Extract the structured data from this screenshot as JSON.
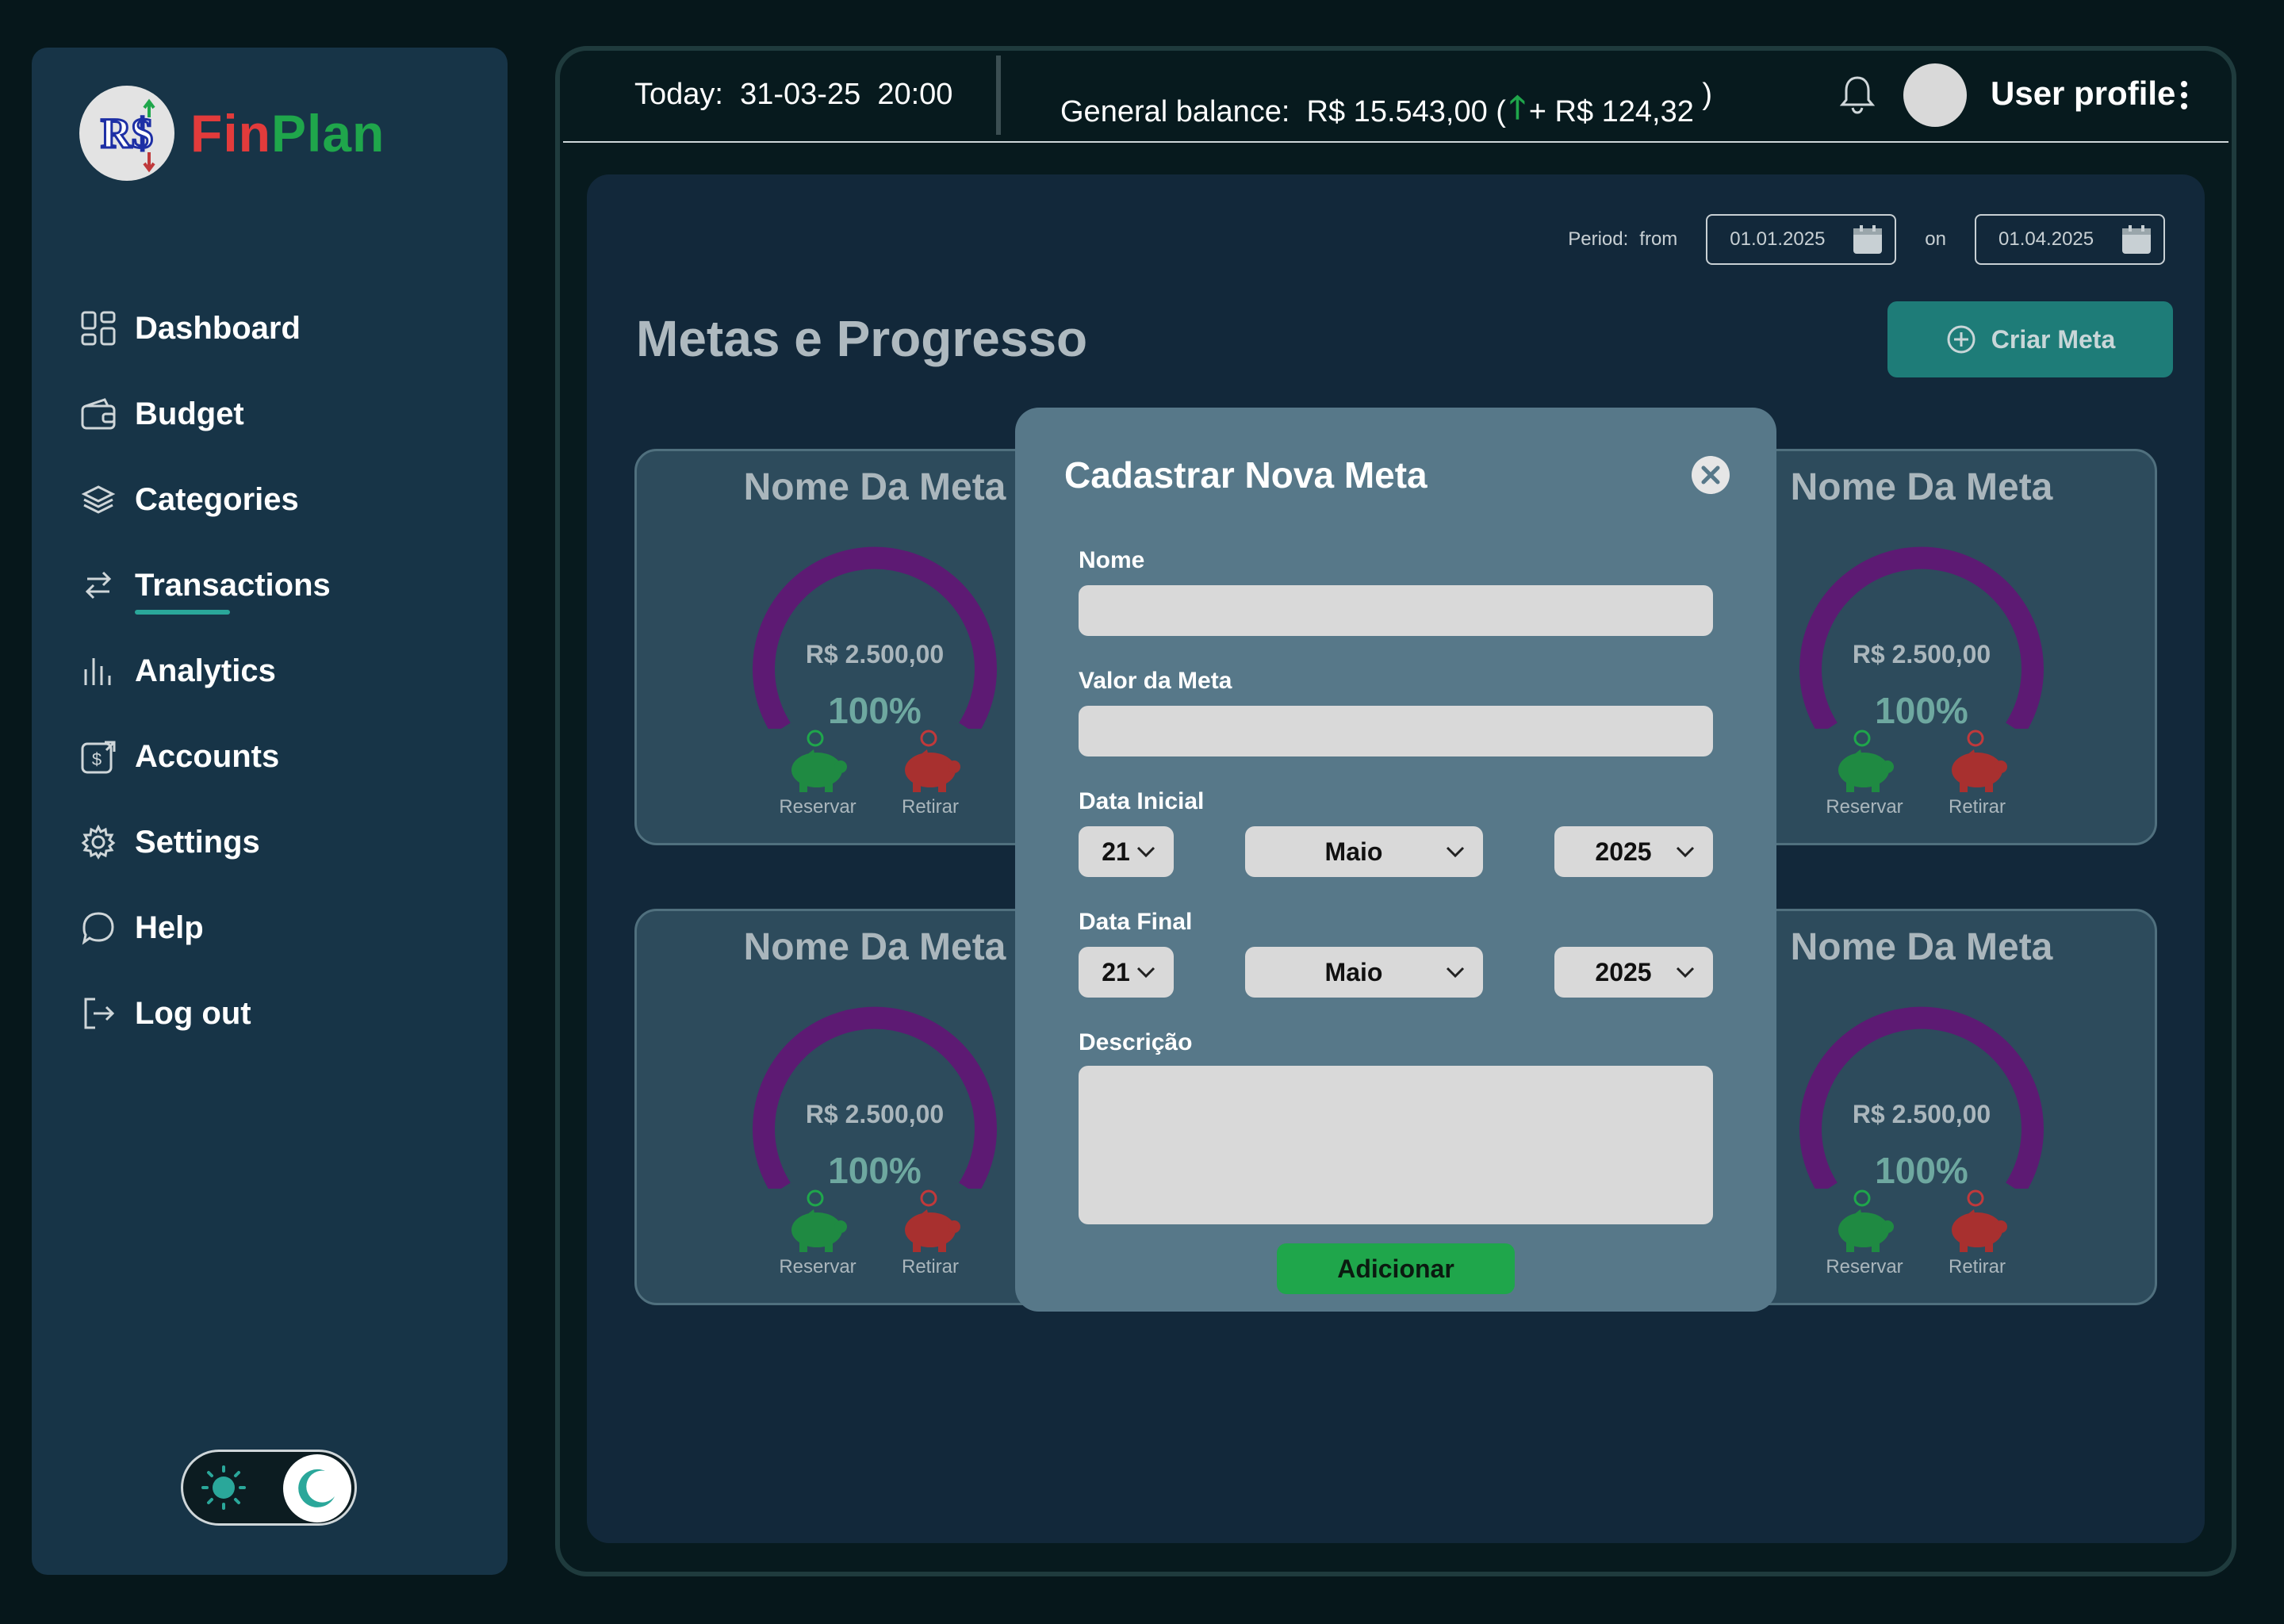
{
  "brand": {
    "name_part1": "Fin",
    "name_part2": "Plan",
    "logo_text": "R$"
  },
  "sidebar": {
    "items": [
      {
        "label": "Dashboard",
        "icon": "dashboard-icon"
      },
      {
        "label": "Budget",
        "icon": "wallet-icon"
      },
      {
        "label": "Categories",
        "icon": "layers-icon"
      },
      {
        "label": "Transactions",
        "icon": "transfer-arrows-icon",
        "active": true
      },
      {
        "label": "Analytics",
        "icon": "bar-chart-icon"
      },
      {
        "label": "Accounts",
        "icon": "dollar-account-icon"
      },
      {
        "label": "Settings",
        "icon": "gear-icon"
      },
      {
        "label": "Help",
        "icon": "chat-bubble-icon"
      },
      {
        "label": "Log out",
        "icon": "logout-icon"
      }
    ],
    "theme": "dark"
  },
  "topbar": {
    "today_label": "Today:",
    "today_date": "31-03-25",
    "today_time": "20:00",
    "balance_label": "General balance:",
    "balance_value": "R$ 15.543,00",
    "balance_change": "+ R$ 124,32",
    "profile_label": "User profile"
  },
  "filters": {
    "period_label": "Period:",
    "from_label": "from",
    "from_date": "01.01.2025",
    "to_label": "on",
    "to_date": "01.04.2025"
  },
  "page": {
    "title": "Metas e Progresso",
    "create_button": "Criar Meta"
  },
  "cards": [
    {
      "title": "Nome Da Meta",
      "amount": "R$ 2.500,00",
      "percent": "100%",
      "progress": 1.0,
      "reserve_label": "Reservar",
      "withdraw_label": "Retirar"
    },
    {
      "title": "Nome Da Meta",
      "amount": "R$ 2.500,00",
      "percent": "100%",
      "progress": 1.0,
      "reserve_label": "Reservar",
      "withdraw_label": "Retirar"
    },
    {
      "title": "Nome Da Meta",
      "amount": "R$ 2.500,00",
      "percent": "100%",
      "progress": 1.0,
      "reserve_label": "Reservar",
      "withdraw_label": "Retirar"
    },
    {
      "title": "Nome Da Meta",
      "amount": "R$ 2.500,00",
      "percent": "100%",
      "progress": 1.0,
      "reserve_label": "Reservar",
      "withdraw_label": "Retirar"
    }
  ],
  "modal": {
    "title": "Cadastrar Nova Meta",
    "name_label": "Nome",
    "name_value": "",
    "value_label": "Valor da Meta",
    "value_value": "",
    "start_label": "Data Inicial",
    "start_day": "21",
    "start_month": "Maio",
    "start_year": "2025",
    "end_label": "Data Final",
    "end_day": "21",
    "end_month": "Maio",
    "end_year": "2025",
    "desc_label": "Descrição",
    "desc_value": "",
    "submit": "Adicionar"
  },
  "colors": {
    "accent": "#2aa79a",
    "positive": "#1fa64b",
    "negative": "#c0393b",
    "gauge": "#5d1a73"
  }
}
